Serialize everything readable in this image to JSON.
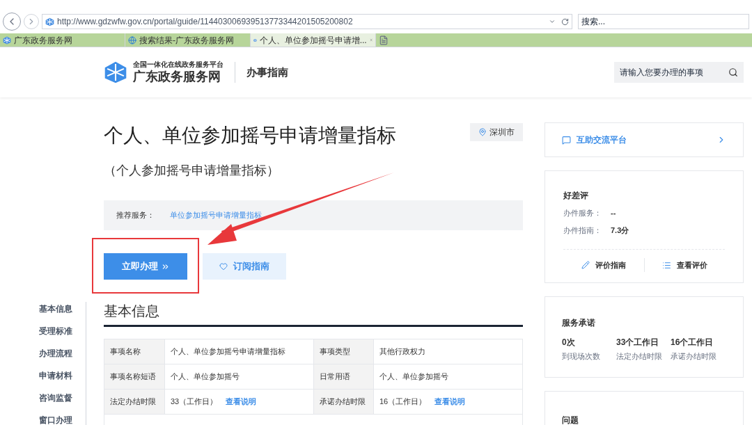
{
  "browser": {
    "url": "http://www.gdzwfw.gov.cn/portal/guide/11440300693951377334420150520080​2",
    "search_placeholder": "搜索...",
    "tabs": [
      {
        "label": "广东政务服务网",
        "selected": false,
        "kind": "site"
      },
      {
        "label": "搜索结果-广东政务服务网",
        "selected": false,
        "kind": "ie"
      },
      {
        "label": "个人、单位参加摇号申请增...",
        "selected": true,
        "kind": "site"
      }
    ]
  },
  "header": {
    "logo_subtitle": "全国一体化在线政务服务平台",
    "logo_title": "广东政务服务网",
    "section": "办事指南",
    "search_placeholder": "请输入您要办理的事项"
  },
  "guide": {
    "title": "个人、单位参加摇号申请增量指标",
    "subtitle": "（个人参加摇号申请增量指标）",
    "location": "深圳市",
    "recommend_label": "推荐服务：",
    "recommend_link": "单位参加摇号申请增量指标",
    "primary_button": "立即办理",
    "secondary_button": "订阅指南"
  },
  "side_nav": [
    {
      "label": "基本信息"
    },
    {
      "label": "受理标准"
    },
    {
      "label": "办理流程"
    },
    {
      "label": "申请材料"
    },
    {
      "label": "咨询监督"
    },
    {
      "label": "窗口办理"
    }
  ],
  "basic_info": {
    "heading": "基本信息",
    "rows": [
      [
        {
          "label": "事项名称",
          "value": "个人、单位参加摇号申请增量指标"
        },
        {
          "label": "事项类型",
          "value": "其他行政权力"
        }
      ],
      [
        {
          "label": "事项名称短语",
          "value": "个人、单位参加摇号"
        },
        {
          "label": "日常用语",
          "value": "个人、单位参加摇号"
        }
      ],
      [
        {
          "label": "法定办结时限",
          "value": "33（工作日）",
          "link": "查看说明"
        },
        {
          "label": "承诺办结时限",
          "value": "16（工作日）",
          "link": "查看说明"
        }
      ]
    ]
  },
  "right": {
    "platform_link": "互助交流平台",
    "rating": {
      "title": "好差评",
      "items": [
        {
          "label": "办件服务：",
          "value": "--"
        },
        {
          "label": "办件指南：",
          "value": "7.3分"
        }
      ],
      "actions": [
        {
          "label": "评价指南",
          "kind": "edit"
        },
        {
          "label": "查看评价",
          "kind": "list"
        }
      ]
    },
    "promise": {
      "title": "服务承诺",
      "stats": [
        {
          "value": "0次",
          "label": "到现场次数"
        },
        {
          "value": "33个工作日",
          "label": "法定办结时限"
        },
        {
          "value": "16个工作日",
          "label": "承诺办结时限"
        }
      ]
    },
    "questions": {
      "title": "问题"
    }
  }
}
